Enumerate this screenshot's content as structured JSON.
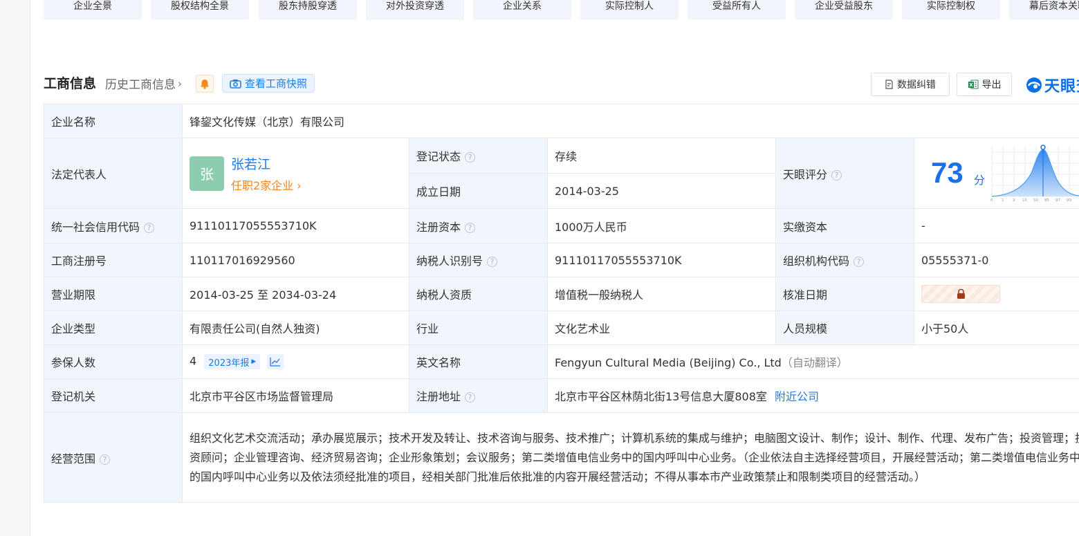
{
  "nav_tabs": [
    "企业全景",
    "股权结构全景",
    "股东持股穿透",
    "对外投资穿透",
    "企业关系",
    "实际控制人",
    "受益所有人",
    "企业受益股东",
    "实际控制权",
    "幕后资本关联"
  ],
  "header": {
    "title": "工商信息",
    "history_label": "历史工商信息",
    "snapshot_label": "查看工商快照",
    "correct_label": "数据纠错",
    "export_label": "导出",
    "logo_text": "天眼查"
  },
  "company": {
    "name_label": "企业名称",
    "name": "锋鋆文化传媒（北京）有限公司",
    "legal_rep_label": "法定代表人",
    "legal_rep_avatar": "张",
    "legal_rep_name": "张若江",
    "legal_rep_jobs": "任职2家企业",
    "reg_status_label": "登记状态",
    "reg_status": "存续",
    "found_date_label": "成立日期",
    "found_date": "2014-03-25",
    "score_label": "天眼评分",
    "score": "73",
    "score_unit": "分",
    "credit_code_label": "统一社会信用代码",
    "credit_code": "91110117055553710K",
    "reg_capital_label": "注册资本",
    "reg_capital": "1000万人民币",
    "paid_capital_label": "实缴资本",
    "paid_capital": "-",
    "reg_no_label": "工商注册号",
    "reg_no": "110117016929560",
    "taxpayer_id_label": "纳税人识别号",
    "taxpayer_id": "91110117055553710K",
    "org_code_label": "组织机构代码",
    "org_code": "05555371-0",
    "term_label": "营业期限",
    "term": "2014-03-25 至 2034-03-24",
    "taxpayer_qual_label": "纳税人资质",
    "taxpayer_qual": "增值税一般纳税人",
    "approve_date_label": "核准日期",
    "type_label": "企业类型",
    "type": "有限责任公司(自然人独资)",
    "industry_label": "行业",
    "industry": "文化艺术业",
    "staff_label": "人员规模",
    "staff": "小于50人",
    "insured_label": "参保人数",
    "insured": "4",
    "insured_year": "2023年报",
    "en_name_label": "英文名称",
    "en_name": "Fengyun Cultural Media (Beijing) Co., Ltd",
    "en_name_note": "（自动翻译）",
    "authority_label": "登记机关",
    "authority": "北京市平谷区市场监督管理局",
    "address_label": "注册地址",
    "address": "北京市平谷区林荫北街13号信息大厦808室",
    "nearby_label": "附近公司",
    "scope_label": "经营范围",
    "scope": "组织文化艺术交流活动；承办展览展示；技术开发及转让、技术咨询与服务、技术推广；计算机系统的集成与维护；电脑图文设计、制作；设计、制作、代理、发布广告；投资管理；投资顾问；企业管理咨询、经济贸易咨询；企业形象策划；会议服务；第二类增值电信业务中的国内呼叫中心业务。（企业依法自主选择经营项目，开展经营活动；第二类增值电信业务中的国内呼叫中心业务以及依法须经批准的项目，经相关部门批准后依批准的内容开展经营活动；不得从事本市产业政策禁止和限制类项目的经营活动。）"
  },
  "score_chart_ticks": [
    "0",
    "1",
    "3",
    "15",
    "50",
    "85",
    "97",
    "99"
  ]
}
